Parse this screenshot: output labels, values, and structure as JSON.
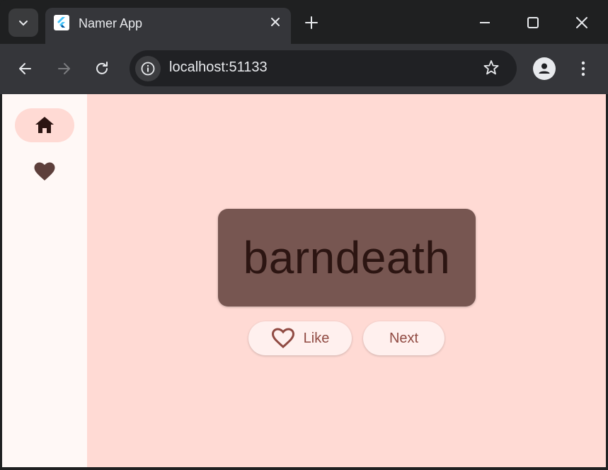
{
  "browser": {
    "tab": {
      "title": "Namer App",
      "favicon": "flutter-icon",
      "close_icon": "close-icon"
    },
    "tab_search_icon": "chevron-down-icon",
    "new_tab_icon": "plus-icon",
    "window_controls": [
      "minimize-icon",
      "maximize-icon",
      "close-icon"
    ],
    "toolbar": {
      "back_icon": "arrow-left-icon",
      "forward_icon": "arrow-right-icon",
      "reload_icon": "reload-icon",
      "site_info_icon": "info-icon",
      "url": "localhost:51133",
      "bookmark_icon": "star-icon",
      "profile_icon": "person-icon",
      "menu_icon": "more-vert-icon"
    }
  },
  "app": {
    "nav_rail": {
      "items": [
        {
          "icon": "home-icon",
          "selected": true
        },
        {
          "icon": "favorite-icon",
          "selected": false
        }
      ]
    },
    "word": "barndeath",
    "buttons": {
      "like_label": "Like",
      "like_icon": "heart-outline-icon",
      "next_label": "Next"
    }
  },
  "colors": {
    "page_background": "#ffdad4",
    "rail_background": "#fff8f6",
    "card_background": "#775651",
    "accent_text": "#904a42",
    "chrome_dark": "#1f2021",
    "chrome_toolbar": "#35363a"
  }
}
